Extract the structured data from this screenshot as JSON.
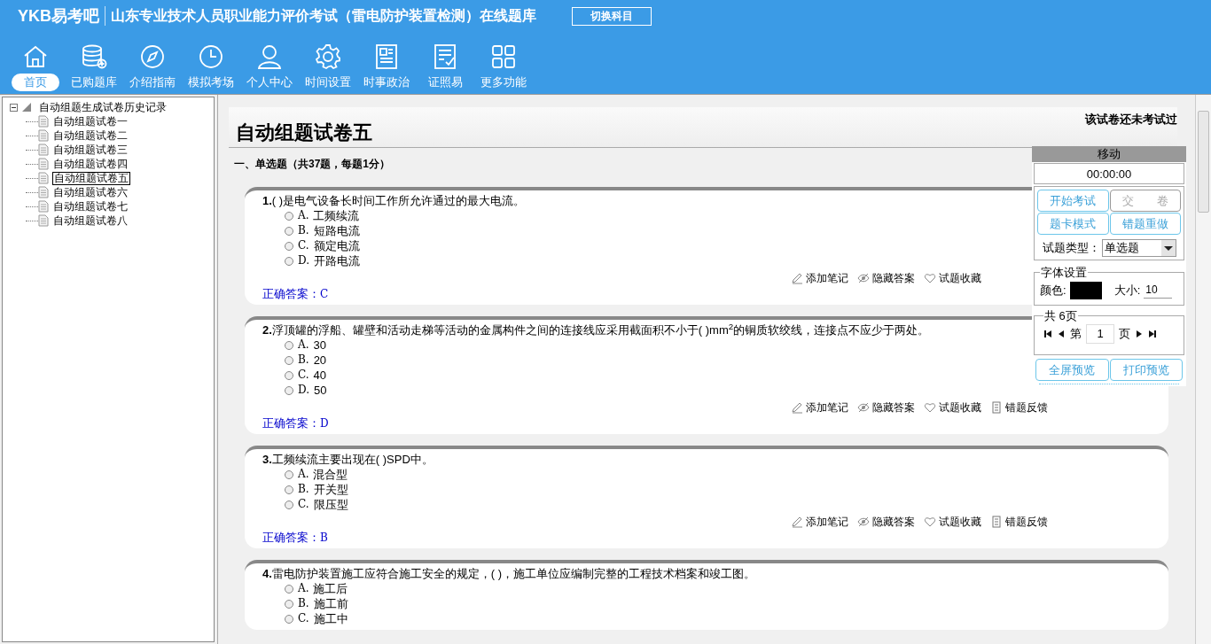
{
  "header": {
    "logo": "YKB易考吧",
    "title": "山东专业技术人员职业能力评价考试（雷电防护装置检测）在线题库",
    "switch_button": "切换科目"
  },
  "nav": [
    {
      "label": "首页",
      "selected": true
    },
    {
      "label": "已购题库",
      "selected": false
    },
    {
      "label": "介绍指南",
      "selected": false
    },
    {
      "label": "模拟考场",
      "selected": false
    },
    {
      "label": "个人中心",
      "selected": false
    },
    {
      "label": "时间设置",
      "selected": false
    },
    {
      "label": "时事政治",
      "selected": false
    },
    {
      "label": "证照易",
      "selected": false
    },
    {
      "label": "更多功能",
      "selected": false
    }
  ],
  "tree": {
    "label": "自动组题生成试卷历史记录",
    "expanded": true,
    "children": [
      {
        "label": "自动组题试卷一",
        "selected": false
      },
      {
        "label": "自动组题试卷二",
        "selected": false
      },
      {
        "label": "自动组题试卷三",
        "selected": false
      },
      {
        "label": "自动组题试卷四",
        "selected": false
      },
      {
        "label": "自动组题试卷五",
        "selected": true
      },
      {
        "label": "自动组题试卷六",
        "selected": false
      },
      {
        "label": "自动组题试卷七",
        "selected": false
      },
      {
        "label": "自动组题试卷八",
        "selected": false
      }
    ]
  },
  "paper": {
    "title": "自动组题试卷五",
    "status": "该试卷还未考试过",
    "section": "一、单选题（共37题，每题1分）"
  },
  "questions": [
    {
      "number": "1.",
      "text": "( )是电气设备长时间工作所允许通过的最大电流。",
      "options": [
        {
          "label": "A.",
          "text": "工频续流",
          "checked": false
        },
        {
          "label": "B.",
          "text": "短路电流",
          "checked": false
        },
        {
          "label": "C.",
          "text": "额定电流",
          "checked": false
        },
        {
          "label": "D.",
          "text": "开路电流",
          "checked": false
        }
      ],
      "actions": [
        "添加笔记",
        "隐藏答案",
        "试题收藏"
      ],
      "answer_label": "正确答案：",
      "answer": "C"
    },
    {
      "number": "2.",
      "text": "浮顶罐的浮船、罐壁和活动走梯等活动的金属构件之间的连接线应采用截面积不小于( )mm$^{2}$的铜质软绞线，连接点不应少于两处。",
      "options": [
        {
          "label": "A.",
          "text": "30",
          "checked": false
        },
        {
          "label": "B.",
          "text": "20",
          "checked": false
        },
        {
          "label": "C.",
          "text": "40",
          "checked": false
        },
        {
          "label": "D.",
          "text": "50",
          "checked": false
        }
      ],
      "actions": [
        "添加笔记",
        "隐藏答案",
        "试题收藏",
        "错题反馈"
      ],
      "answer_label": "正确答案：",
      "answer": "D"
    },
    {
      "number": "3.",
      "text": "工频续流主要出现在( )SPD中。",
      "options": [
        {
          "label": "A.",
          "text": "混合型",
          "checked": false
        },
        {
          "label": "B.",
          "text": "开关型",
          "checked": false
        },
        {
          "label": "C.",
          "text": "限压型",
          "checked": false
        }
      ],
      "actions": [
        "添加笔记",
        "隐藏答案",
        "试题收藏",
        "错题反馈"
      ],
      "answer_label": "正确答案：",
      "answer": "B"
    },
    {
      "number": "4.",
      "text": "雷电防护装置施工应符合施工安全的规定，( )，施工单位应编制完整的工程技术档案和竣工图。",
      "options": [
        {
          "label": "A.",
          "text": "施工后",
          "checked": false
        },
        {
          "label": "B.",
          "text": "施工前",
          "checked": false
        },
        {
          "label": "C.",
          "text": "施工中",
          "checked": false
        }
      ]
    }
  ],
  "panel": {
    "move_label": "移动",
    "timer": "00:00:00",
    "buttons": [
      {
        "label": "开始考试",
        "disabled": false
      },
      {
        "label": "交　　卷",
        "disabled": true
      },
      {
        "label": "题卡模式",
        "disabled": false
      },
      {
        "label": "错题重做",
        "disabled": false
      }
    ],
    "type_label": "试题类型：",
    "type_value": "单选题",
    "font_legend": "字体设置",
    "color_label": "颜色:",
    "color": "#000000",
    "size_label": "大小:",
    "size_value": "10",
    "pages_legend": "共 6页",
    "page_prefix": "第",
    "page_value": "1",
    "page_suffix": "页",
    "preview_buttons": [
      "全屏预览",
      "打印预览"
    ]
  }
}
